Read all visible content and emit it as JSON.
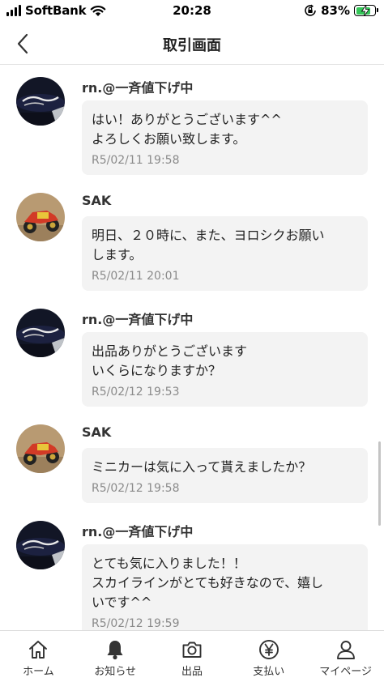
{
  "status_bar": {
    "carrier": "SoftBank",
    "time": "20:28",
    "battery_percent": "83%",
    "battery_level": 0.83
  },
  "header": {
    "title": "取引画面",
    "back_icon": "chevron-left-icon"
  },
  "messages": [
    {
      "sender": "rn.@一斉値下げ中",
      "avatar": "coca-cola-avatar",
      "text": "はい！ありがとうございます^^\nよろしくお願い致します。",
      "time": "R5/02/11 19:58"
    },
    {
      "sender": "SAK",
      "avatar": "minicar-avatar",
      "text": "明日、２０時に、また、ヨロシクお願い\nします。",
      "time": "R5/02/11 20:01"
    },
    {
      "sender": "rn.@一斉値下げ中",
      "avatar": "coca-cola-avatar",
      "text": "出品ありがとうございます\nいくらになりますか？",
      "time": "R5/02/12 19:53"
    },
    {
      "sender": "SAK",
      "avatar": "minicar-avatar",
      "text": "ミニカーは気に入って貰えましたか？",
      "time": "R5/02/12 19:58"
    },
    {
      "sender": "rn.@一斉値下げ中",
      "avatar": "coca-cola-avatar",
      "text": "とても気に入りました！！\nスカイラインがとても好きなので、嬉し\nいです^^",
      "time": "R5/02/12 19:59"
    }
  ],
  "tabs": [
    {
      "label": "ホーム",
      "icon": "home-icon"
    },
    {
      "label": "お知らせ",
      "icon": "bell-icon"
    },
    {
      "label": "出品",
      "icon": "camera-icon"
    },
    {
      "label": "支払い",
      "icon": "yen-icon"
    },
    {
      "label": "マイページ",
      "icon": "person-icon"
    }
  ],
  "colors": {
    "bubble_bg": "#f3f3f3",
    "timestamp": "#8a8a8a",
    "battery_fill": "#35c759"
  }
}
